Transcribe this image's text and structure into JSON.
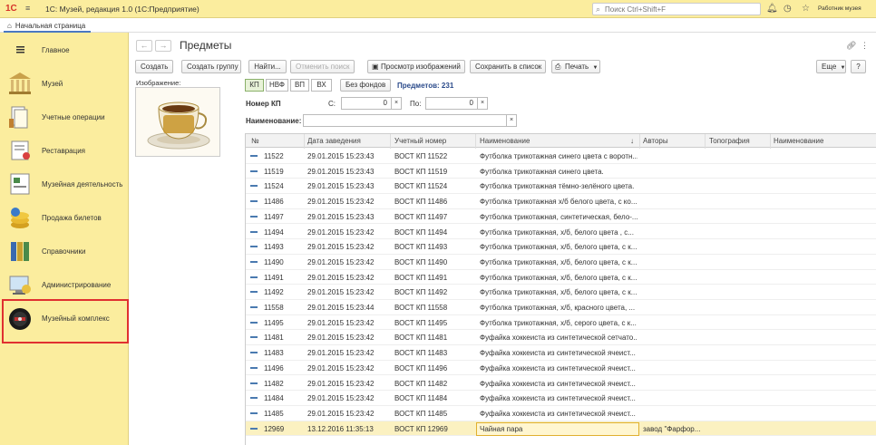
{
  "titlebar": {
    "logo": "1С",
    "app_title": "1С: Музей, редакция 1.0  (1С:Предприятие)",
    "search_placeholder": "Поиск Ctrl+Shift+F",
    "user": "Работник музея"
  },
  "tabs": {
    "home": "Начальная страница"
  },
  "sidebar": {
    "items": [
      {
        "label": "Главное",
        "icon": "hamburger-icon"
      },
      {
        "label": "Музей",
        "icon": "museum-icon"
      },
      {
        "label": "Учетные операции",
        "icon": "documents-icon"
      },
      {
        "label": "Реставрация",
        "icon": "restoration-icon"
      },
      {
        "label": "Музейная деятельность",
        "icon": "activity-icon"
      },
      {
        "label": "Продажа билетов",
        "icon": "coins-icon"
      },
      {
        "label": "Справочники",
        "icon": "books-icon"
      },
      {
        "label": "Администрирование",
        "icon": "admin-icon"
      },
      {
        "label": "Музейный комплекс",
        "icon": "complex-icon"
      }
    ]
  },
  "main": {
    "title": "Предметы",
    "toolbar": {
      "create": "Создать",
      "create_group": "Создать группу",
      "find": "Найти...",
      "cancel_search": "Отменить поиск",
      "view_images": "Просмотр изображений",
      "save_to_list": "Сохранить в список",
      "print": "Печать",
      "more": "Еще",
      "help": "?"
    },
    "image_label": "Изображение:",
    "filter_tabs": [
      "КП",
      "НВФ",
      "ВП",
      "ВХ"
    ],
    "without_funds": "Без фондов",
    "count_label": "Предметов: 231",
    "number_label": "Номер КП",
    "from_label": "С:",
    "from_value": "0",
    "to_label": "По:",
    "to_value": "0",
    "clear": "×",
    "name_label": "Наименование:",
    "table": {
      "columns": [
        "№",
        "Дата заведения",
        "Учетный номер",
        "Наименование",
        "Авторы",
        "Топография",
        "Наименование"
      ],
      "rows": [
        [
          "11522",
          "29.01.2015 15:23:43",
          "ВОСТ КП 11522",
          "Футболка трикотажная синего цвета с воротн...",
          ""
        ],
        [
          "11519",
          "29.01.2015 15:23:43",
          "ВОСТ КП 11519",
          "Футболка трикотажная синего цвета.",
          ""
        ],
        [
          "11524",
          "29.01.2015 15:23:43",
          "ВОСТ КП 11524",
          "Футболка трикотажная тёмно-зелёного цвета.",
          ""
        ],
        [
          "11486",
          "29.01.2015 15:23:42",
          "ВОСТ КП 11486",
          "Футболка трикотажная х/б белого цвета, с ко...",
          ""
        ],
        [
          "11497",
          "29.01.2015 15:23:43",
          "ВОСТ КП 11497",
          "Футболка трикотажная, синтетическая, бело-...",
          ""
        ],
        [
          "11494",
          "29.01.2015 15:23:42",
          "ВОСТ КП 11494",
          "Футболка трикотажная, х/б, белого  цвета , с...",
          ""
        ],
        [
          "11493",
          "29.01.2015 15:23:42",
          "ВОСТ КП 11493",
          "Футболка трикотажная, х/б, белого цвета, с к...",
          ""
        ],
        [
          "11490",
          "29.01.2015 15:23:42",
          "ВОСТ КП 11490",
          "Футболка трикотажная, х/б, белого цвета, с к...",
          ""
        ],
        [
          "11491",
          "29.01.2015 15:23:42",
          "ВОСТ КП 11491",
          "Футболка трикотажная, х/б, белого цвета, с к...",
          ""
        ],
        [
          "11492",
          "29.01.2015 15:23:42",
          "ВОСТ КП 11492",
          "Футболка трикотажная, х/б, белого цвета, с к...",
          ""
        ],
        [
          "11558",
          "29.01.2015 15:23:44",
          "ВОСТ КП 11558",
          "Футболка трикотажная, х/б, красного цвета, ...",
          ""
        ],
        [
          "11495",
          "29.01.2015 15:23:42",
          "ВОСТ КП 11495",
          "Футболка трикотажная, х/б, серого цвета, с к...",
          ""
        ],
        [
          "11481",
          "29.01.2015 15:23:42",
          "ВОСТ КП 11481",
          "Фуфайка хоккеиста из синтетической сетчато...",
          ""
        ],
        [
          "11483",
          "29.01.2015 15:23:42",
          "ВОСТ КП 11483",
          "Фуфайка хоккеиста из синтетической ячеист...",
          ""
        ],
        [
          "11496",
          "29.01.2015 15:23:42",
          "ВОСТ КП 11496",
          "Фуфайка хоккеиста из синтетической ячеист...",
          ""
        ],
        [
          "11482",
          "29.01.2015 15:23:42",
          "ВОСТ КП 11482",
          "Фуфайка хоккеиста из синтетической ячеист...",
          ""
        ],
        [
          "11484",
          "29.01.2015 15:23:42",
          "ВОСТ КП 11484",
          "Фуфайка хоккеиста из синтетической ячеист...",
          ""
        ],
        [
          "11485",
          "29.01.2015 15:23:42",
          "ВОСТ КП 11485",
          "Фуфайка хоккеиста из синтетической ячеист...",
          ""
        ],
        [
          "12969",
          "13.12.2016 11:35:13",
          "ВОСТ КП 12969",
          "Чайная пара",
          "завод \"Фарфор..."
        ]
      ],
      "selected_row": 18,
      "sort_indicator": "↓"
    }
  },
  "colors": {
    "sidebar_bg": "#fbed9e",
    "highlight": "#e03030",
    "selection": "#fbf1c1",
    "accent": "#4a78c2"
  }
}
